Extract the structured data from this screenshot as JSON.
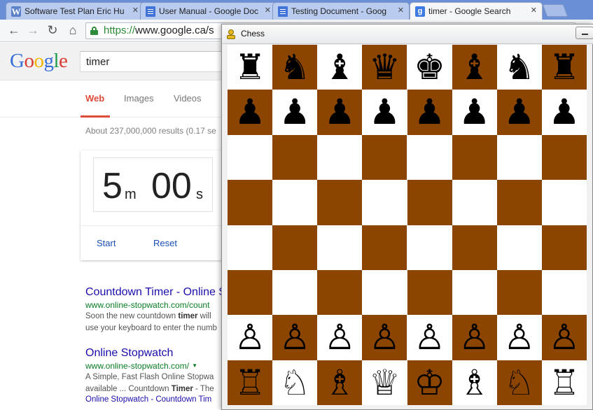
{
  "browser": {
    "tabs": [
      {
        "label": "Software Test Plan Eric Hu",
        "icon": "word-icon"
      },
      {
        "label": "User Manual - Google Doc",
        "icon": "google-docs-icon"
      },
      {
        "label": "Testing Document - Goog",
        "icon": "google-docs-icon"
      },
      {
        "label": "timer - Google Search",
        "icon": "google-icon"
      }
    ],
    "url_scheme": "https://",
    "url_rest": "www.google.ca/s"
  },
  "google": {
    "logo": [
      "G",
      "o",
      "o",
      "g",
      "l",
      "e"
    ],
    "query": "timer",
    "tabs": [
      "Web",
      "Images",
      "Videos"
    ],
    "active_tab": "Web",
    "result_stats": "About 237,000,000 results (0.17 se",
    "timer": {
      "minutes": "5",
      "minutes_unit": "m",
      "seconds": "00",
      "seconds_unit": "s",
      "start_label": "Start",
      "reset_label": "Reset"
    },
    "results": [
      {
        "title": "Countdown Timer - Online S",
        "url": "www.online-stopwatch.com/count",
        "snippet_1a": "Soon the new countdown ",
        "snippet_1b": "timer",
        "snippet_1c": " will",
        "snippet_2": "use your keyboard to enter the numb"
      },
      {
        "title": "Online Stopwatch",
        "url": "www.online-stopwatch.com/",
        "snippet_1": "A Simple, Fast Flash Online Stopwa",
        "snippet_2a": "available ... Countdown ",
        "snippet_2b": "Timer",
        "snippet_2c": " - The",
        "sitelinks": "Online Stopwatch - Countdown Tim"
      }
    ]
  },
  "chess_window": {
    "title": "Chess",
    "colors": {
      "light": "#ffffff",
      "dark": "#8b4500"
    },
    "board": [
      [
        "br",
        "bn",
        "bb",
        "bq",
        "bk",
        "bb",
        "bn",
        "br"
      ],
      [
        "bp",
        "bp",
        "bp",
        "bp",
        "bp",
        "bp",
        "bp",
        "bp"
      ],
      [
        "",
        "",
        "",
        "",
        "",
        "",
        "",
        ""
      ],
      [
        "",
        "",
        "",
        "",
        "",
        "",
        "",
        ""
      ],
      [
        "",
        "",
        "",
        "",
        "",
        "",
        "",
        ""
      ],
      [
        "",
        "",
        "",
        "",
        "",
        "",
        "",
        ""
      ],
      [
        "wp",
        "wp",
        "wp",
        "wp",
        "wp",
        "wp",
        "wp",
        "wp"
      ],
      [
        "wr",
        "wn",
        "wb",
        "wq",
        "wk",
        "wb",
        "wn",
        "wr"
      ]
    ]
  }
}
